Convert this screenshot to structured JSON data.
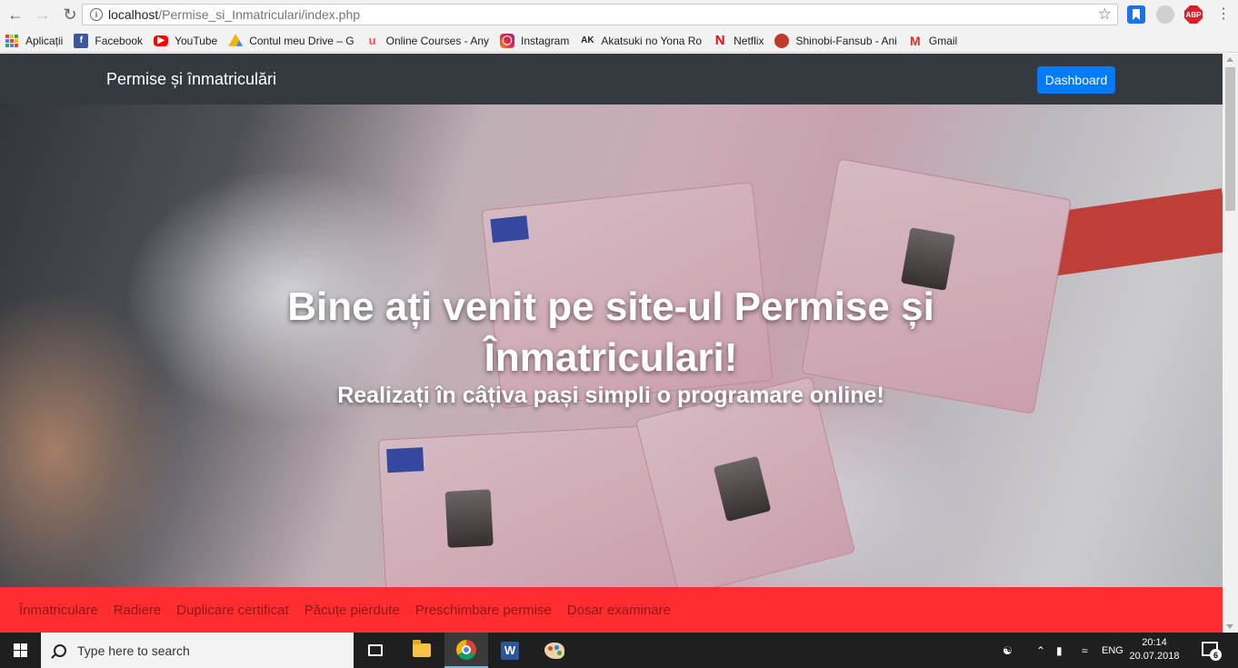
{
  "browser": {
    "url_host": "localhost",
    "url_path": "/Permise_si_Inmatriculari/index.php"
  },
  "bookmarks": [
    {
      "label": "Aplicații",
      "icon": "apps-grid-icon"
    },
    {
      "label": "Facebook",
      "icon": "facebook-icon",
      "color": "#3b5998"
    },
    {
      "label": "YouTube",
      "icon": "youtube-icon",
      "color": "#ff0000"
    },
    {
      "label": "Contul meu Drive – G",
      "icon": "google-drive-icon"
    },
    {
      "label": "Online Courses - Any",
      "icon": "udemy-icon",
      "color": "#ec5252"
    },
    {
      "label": "Instagram",
      "icon": "instagram-icon",
      "color": "#c13584"
    },
    {
      "label": "Akatsuki no Yona Ro",
      "icon": "ak-icon"
    },
    {
      "label": "Netflix",
      "icon": "netflix-icon",
      "color": "#e50914"
    },
    {
      "label": "Shinobi-Fansub - Ani",
      "icon": "shinobi-icon"
    },
    {
      "label": "Gmail",
      "icon": "gmail-icon",
      "color": "#d93025"
    }
  ],
  "navbar": {
    "brand": "Permise și înmatriculări",
    "dashboard_label": "Dashboard"
  },
  "hero": {
    "title": "Bine ați venit pe site-ul Permise și Înmatriculari!",
    "subtitle": "Realizați în câțiva pași simpli o programare online!"
  },
  "menu": [
    "Înmatriculare",
    "Radiere",
    "Duplicare certificat",
    "Păcuțe pierdute",
    "Preschimbare permise",
    "Dosar examinare"
  ],
  "taskbar": {
    "search_placeholder": "Type here to search",
    "language": "ENG",
    "time": "20:14",
    "date": "20.07.2018",
    "notifications": "6"
  },
  "extensions": {
    "abp": "ABP"
  },
  "colors": {
    "navbar": "#343a40",
    "primary": "#007bff",
    "redbar": "#ff2d2d",
    "menu_text": "#8b1a1a"
  }
}
